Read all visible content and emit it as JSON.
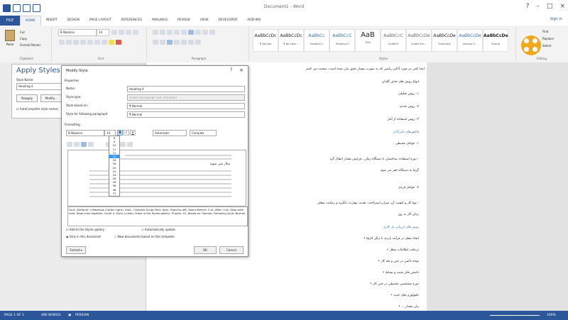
{
  "window": {
    "title": "Document1 - Word",
    "user": "Sign in"
  },
  "tabs": [
    "FILE",
    "HOME",
    "INSERT",
    "DESIGN",
    "PAGE LAYOUT",
    "REFERENCES",
    "MAILINGS",
    "REVIEW",
    "VIEW",
    "DEVELOPER",
    "ADD-INS"
  ],
  "ribbon": {
    "clipboard": {
      "paste": "Paste",
      "cut": "Cut",
      "copy": "Copy",
      "format_painter": "Format Painter",
      "label": "Clipboard"
    },
    "font": {
      "name": "B Nazanin",
      "size": "14",
      "label": "Font"
    },
    "paragraph": {
      "label": "Paragraph"
    },
    "styles": {
      "label": "Styles",
      "items": [
        {
          "preview": "AaBbCcDc",
          "name": "¶ Normal"
        },
        {
          "preview": "AaBbCcDc",
          "name": "¶ No Spac..."
        },
        {
          "preview": "AaBbCc",
          "name": "Heading 1"
        },
        {
          "preview": "AaBbCcC",
          "name": "Heading 2"
        },
        {
          "preview": "AaB",
          "name": "Title"
        },
        {
          "preview": "AaBbCcC",
          "name": "Subtitle"
        },
        {
          "preview": "AaBbCcDe",
          "name": "Subtle Em..."
        },
        {
          "preview": "AaBbCcDe",
          "name": "Emphasis"
        },
        {
          "preview": "AaBbCcDe",
          "name": "Intense E..."
        },
        {
          "preview": "AaBbCcDe",
          "name": "Strong"
        }
      ]
    },
    "editing": {
      "find": "Find",
      "replace": "Replace",
      "select": "Select",
      "label": "Editing"
    }
  },
  "apply_styles": {
    "title": "Apply Styles",
    "style_name_label": "Style Name:",
    "style_name_value": "Heading 4",
    "reapply": "Reapply",
    "modify": "Modify...",
    "autocomplete": "AutoComplete style names"
  },
  "dialog": {
    "title": "Modify Style",
    "help": "?",
    "close": "×",
    "properties_label": "Properties",
    "rows": [
      {
        "key": "Name:",
        "value": "Heading 4",
        "disabled": false
      },
      {
        "key": "Style type:",
        "value": "Linked (paragraph and character)",
        "disabled": true
      },
      {
        "key": "Style based on:",
        "value": "¶ Normal",
        "disabled": false
      },
      {
        "key": "Style for following paragraph:",
        "value": "¶ Normal",
        "disabled": false
      }
    ],
    "formatting_label": "Formatting",
    "font": "B Nazanin",
    "size": "14",
    "color": "Automatic",
    "script": "Complex",
    "size_list": [
      "8",
      "9",
      "10",
      "11",
      "12",
      "14",
      "16",
      "18",
      "20",
      "22",
      "24",
      "26",
      "28",
      "36",
      "48",
      "72"
    ],
    "size_selected": "14",
    "preview_text": "مثال متن نمونه",
    "description": "Font: (Default) +Headings (Calibri Light), Italic, Complex Script Font: Italic, Right-to-left, Space Before: 2 pt, After: 0 pt, Keep with next, Keep lines together, Level 4, Style: Linked, Show in the Styles gallery, Priority: 10, Based on: Normal, Following style: Normal",
    "add_to_gallery": "Add to the Styles gallery",
    "auto_update": "Automatically update",
    "only_this_doc": "Only in this document",
    "new_docs": "New documents based on this template",
    "format_btn": "Format ▾",
    "ok": "OK",
    "cancel": "Cancel"
  },
  "document": {
    "lines": [
      {
        "text": "ابتدا کمی در مورد آنالیز ریاضی که به صورت بسیار دقیق بیان شده است، صحبت می کنیم",
        "type": "normal"
      },
      {
        "text": "انواع روش های حذف گلدان",
        "type": "normal"
      },
      {
        "text": "۱- روش تحلیلی",
        "type": "normal"
      },
      {
        "text": "۲- روش عددی",
        "type": "normal"
      },
      {
        "text": "۳- روش استفاده از آمار",
        "type": "normal"
      },
      {
        "text": "فاکتورهای تاثیرگذار",
        "type": "head"
      },
      {
        "text": "۱- عوامل محیطی",
        "type": "normal"
      },
      {
        "text": "- دوره استفاده، ساختمان با دستگاه زمان ، فرایش مقدار انتقال گرد",
        "type": "normal"
      },
      {
        "text": "گرما به دستگاه حفر می شود",
        "type": "normal"
      },
      {
        "text": "۲- عوامل فردی",
        "type": "normal"
      },
      {
        "text": "- نوع کار و کیفیت آن، میزان استراحت، تغذیه، مهارت، انگیزه و رضایت شغلی",
        "type": "normal"
      },
      {
        "text": "زمان کار به روز",
        "type": "normal"
      },
      {
        "text": "روش های ارزیابی بار کاری",
        "type": "head"
      },
      {
        "text": "ایجاد شغل در فرآیند بازدید با دیگر کارها",
        "type": "bullet"
      },
      {
        "text": "دریافت اطلاعات شغل",
        "type": "bullet"
      },
      {
        "text": "توجه دائمی در حین و بعد کار",
        "type": "bullet"
      },
      {
        "text": "داشتن فکر مثبت و نشاط",
        "type": "bullet"
      },
      {
        "text": "دوره مشخصی تحصیلی در حین کار",
        "type": "bullet"
      },
      {
        "text": "تکنولوژی های جدید",
        "type": "bullet"
      },
      {
        "text": "بیان مقدار ...",
        "type": "bullet"
      }
    ]
  },
  "status": {
    "page": "PAGE 1 OF 1",
    "words": "480 WORDS",
    "language": "PERSIAN",
    "zoom": "100%"
  },
  "colors": {
    "accent": "#2b579a",
    "heading": "#2e74b5",
    "logo": "#f2a81d"
  }
}
